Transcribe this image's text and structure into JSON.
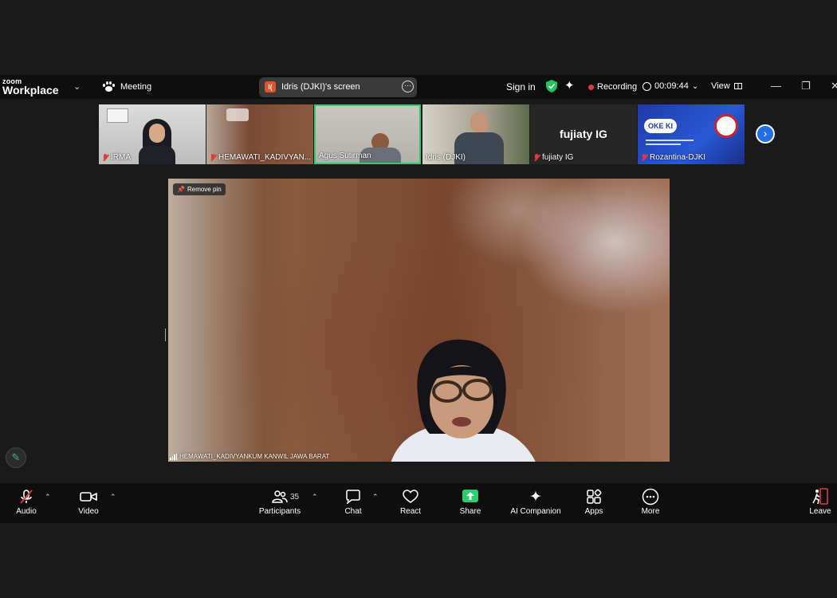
{
  "app": {
    "logo_top": "zoom",
    "logo_bottom": "Workplace",
    "meeting_label": "Meeting",
    "screen_share_label": "Idris (DJKI)'s screen",
    "screen_share_icon_text": "I(",
    "sign_in": "Sign in",
    "recording_label": "Recording",
    "timer": "00:09:44",
    "view_label": "View",
    "colors": {
      "accent": "#1e6fe8",
      "recording": "#e53935",
      "shield": "#22c55e",
      "active_speaker": "#2ecc71",
      "share_green": "#2ecc71"
    }
  },
  "participants_strip": [
    {
      "name": "IRMA",
      "muted": true
    },
    {
      "name": "HEMAWATI_KADIVYAN...",
      "muted": true
    },
    {
      "name": "Agus Sutirman",
      "muted": false,
      "active": true
    },
    {
      "name": "Idris (DJKI)",
      "muted": false
    },
    {
      "name": "fujiaty IG",
      "muted": true,
      "no_video": true,
      "display": "fujiaty IG"
    },
    {
      "name": "Rozantina-DJKI",
      "muted": true,
      "slide_text": "OKE KI"
    }
  ],
  "main_video": {
    "remove_pin_label": "Remove pin",
    "speaker_name": "HEMAWATI_KADIVYANKUM KANWIL JAWA BARAT"
  },
  "toolbar": {
    "audio": "Audio",
    "video": "Video",
    "participants": "Participants",
    "participants_count": "35",
    "chat": "Chat",
    "react": "React",
    "share": "Share",
    "ai_companion": "AI Companion",
    "apps": "Apps",
    "more": "More",
    "leave": "Leave"
  },
  "icons": [
    "chevron-down-icon",
    "paw-icon",
    "more-icon",
    "shield-icon",
    "sparkle-icon",
    "clock-icon",
    "grid-icon",
    "minimize-icon",
    "restore-icon",
    "close-icon",
    "mic-off-icon",
    "pin-icon",
    "signal-icon",
    "pencil-icon",
    "camera-icon",
    "people-icon",
    "chat-icon",
    "heart-icon",
    "share-icon",
    "apps-icon",
    "leave-icon"
  ]
}
